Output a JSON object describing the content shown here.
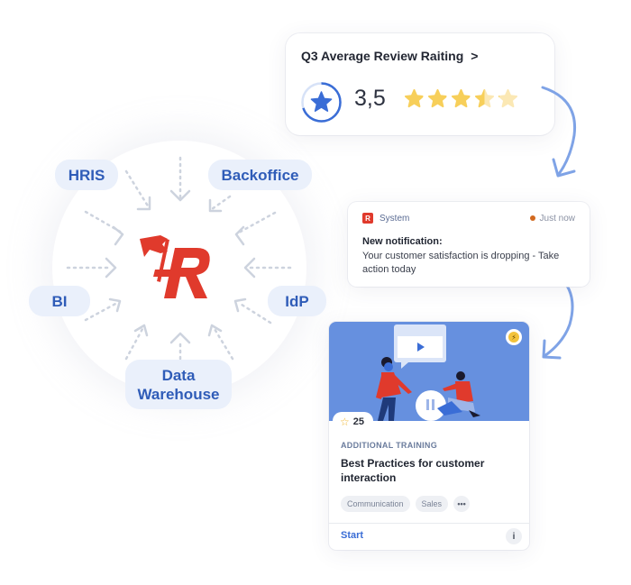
{
  "hub": {
    "sources": [
      {
        "id": "hris",
        "label": "HRIS"
      },
      {
        "id": "backoffice",
        "label": "Backoffice"
      },
      {
        "id": "bi",
        "label": "BI"
      },
      {
        "id": "idp",
        "label": "IdP"
      },
      {
        "id": "data-warehouse",
        "label": "Data Warehouse"
      }
    ],
    "logo_color": "#e03a2c"
  },
  "rating_card": {
    "title": "Q3 Average Review Raiting",
    "chevron": ">",
    "value_label": "3,5",
    "rating": 3.5,
    "max_rating": 5,
    "accent": "#3a6dd6",
    "star_color": "#f7cf5a"
  },
  "notification": {
    "source": "System",
    "source_icon": "R",
    "time": "Just now",
    "status_color": "#d2691e",
    "title": "New notification:",
    "body": "Your customer satisfaction is dropping - Take action today"
  },
  "course_card": {
    "likes": "25",
    "likes_icon": "☆",
    "category": "ADDITIONAL TRAINING",
    "title": "Best Practices for customer interaction",
    "tags": [
      "Communication",
      "Sales"
    ],
    "more_tags": "•••",
    "start_label": "Start",
    "info_label": "i",
    "bolt_icon": "⚡",
    "hero_color": "#6690df"
  }
}
